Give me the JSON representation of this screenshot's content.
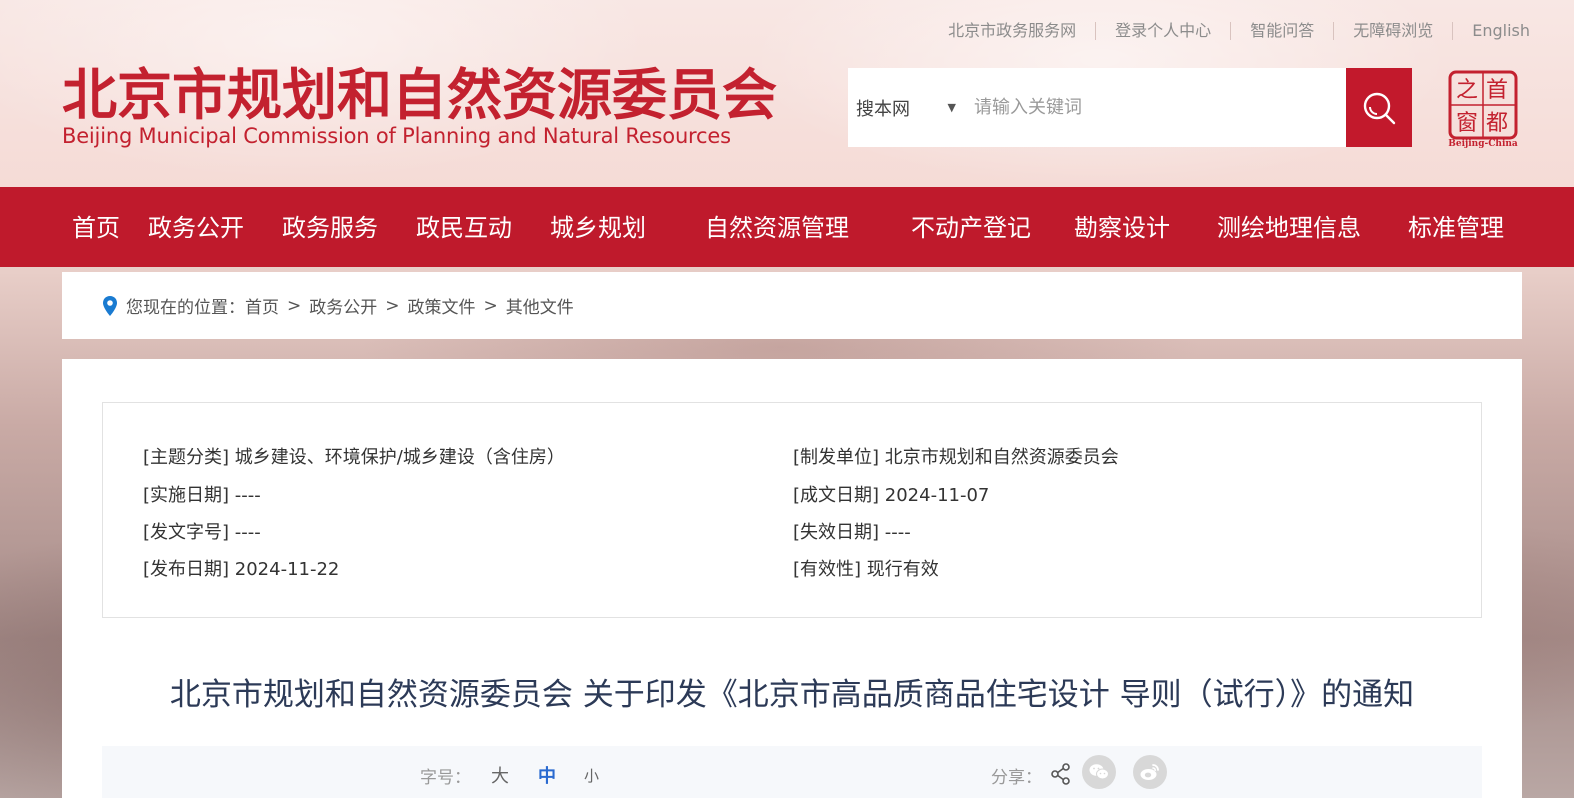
{
  "header": {
    "top_links": [
      "北京市政务服务网",
      "登录个人中心",
      "智能问答",
      "无障碍浏览",
      "English"
    ],
    "logo_cn": "北京市规划和自然资源委员会",
    "logo_en": "Beijing Municipal Commission of Planning and Natural Resources",
    "search": {
      "scope": "搜本网",
      "placeholder": "请输入关键词",
      "value": ""
    },
    "capital_badge": {
      "chars": [
        "首",
        "都",
        "之",
        "窗"
      ],
      "caption": "Beijing-China"
    }
  },
  "nav": {
    "items": [
      "首页",
      "政务公开",
      "政务服务",
      "政民互动",
      "城乡规划",
      "自然资源管理",
      "不动产登记",
      "勘察设计",
      "测绘地理信息",
      "标准管理"
    ]
  },
  "breadcrumb": {
    "prefix": "您现在的位置：",
    "items": [
      "首页",
      "政务公开",
      "政策文件",
      "其他文件"
    ],
    "separator": ">"
  },
  "meta": {
    "theme": "[主题分类] 城乡建设、环境保护/城乡建设（含住房）",
    "issuer": "[制发单位] 北京市规划和自然资源委员会",
    "effective_date": "[实施日期] ----",
    "written_date": "[成文日期] 2024-11-07",
    "doc_number": "[发文字号] ----",
    "expiry_date": "[失效日期] ----",
    "publish_date": "[发布日期] 2024-11-22",
    "validity": "[有效性] 现行有效"
  },
  "article": {
    "title": "北京市规划和自然资源委员会 关于印发《北京市高品质商品住宅设计 导则（试行）》的通知"
  },
  "tools": {
    "font_label": "字号：",
    "font_large": "大",
    "font_medium": "中",
    "font_small": "小",
    "share_label": "分享：",
    "icons": [
      "share-icon",
      "wechat-icon",
      "weibo-icon"
    ]
  },
  "colors": {
    "brand_red": "#bf1a2c",
    "title_navy": "#2c3a57",
    "active_blue": "#2a6ad0",
    "pin_blue": "#1a7bd1"
  }
}
